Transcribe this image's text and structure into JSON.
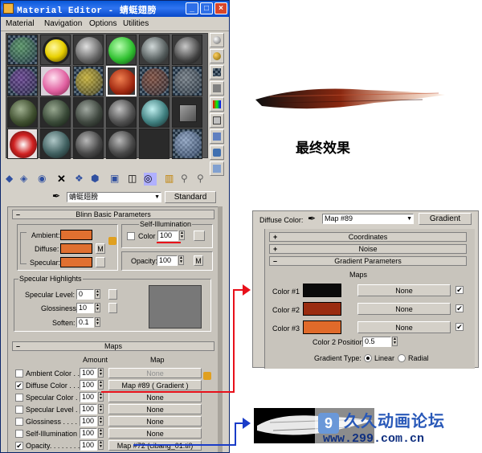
{
  "window": {
    "title": "Material Editor - 蜻蜓翅膀",
    "menu": [
      "Material",
      "Navigation",
      "Options",
      "Utilities"
    ],
    "material_name": "蜻蜓翅膀",
    "material_type": "Standard"
  },
  "blinn": {
    "header": "Blinn Basic Parameters",
    "ambient_label": "Ambient:",
    "diffuse_label": "Diffuse:",
    "specular_label": "Specular:",
    "map_btn": "M",
    "self_illum_title": "Self-Illumination",
    "color_label": "Color",
    "self_illum_value": "100",
    "opacity_label": "Opacity:",
    "opacity_value": "100",
    "opacity_map_btn": "M",
    "ambient_color": "#e07030",
    "diffuse_color": "#e07030",
    "specular_color": "#e07030"
  },
  "specular": {
    "title": "Specular Highlights",
    "level_label": "Specular Level:",
    "level_value": "0",
    "gloss_label": "Glossiness:",
    "gloss_value": "10",
    "soften_label": "Soften:",
    "soften_value": "0.1"
  },
  "maps": {
    "header": "Maps",
    "col_amount": "Amount",
    "col_map": "Map",
    "rows": [
      {
        "label": "Ambient Color . . .",
        "checked": false,
        "amount": "100",
        "map": "None",
        "enabled": false
      },
      {
        "label": "Diffuse Color . . .",
        "checked": true,
        "amount": "100",
        "map": "Map #89  ( Gradient )",
        "enabled": true
      },
      {
        "label": "Specular Color . .",
        "checked": false,
        "amount": "100",
        "map": "None",
        "enabled": true
      },
      {
        "label": "Specular Level . .",
        "checked": false,
        "amount": "100",
        "map": "None",
        "enabled": true
      },
      {
        "label": "Glossiness . . . . .",
        "checked": false,
        "amount": "100",
        "map": "None",
        "enabled": true
      },
      {
        "label": "Self-Illumination .",
        "checked": false,
        "amount": "100",
        "map": "None",
        "enabled": true
      },
      {
        "label": "Opacity. . . . . . . .",
        "checked": true,
        "amount": "100",
        "map": "Map #72 (cibang_01.tif)",
        "enabled": true
      }
    ]
  },
  "result_label": "最终效果",
  "gradient_panel": {
    "diffuse_label": "Diffuse Color:",
    "map_name": "Map #89",
    "map_type": "Gradient",
    "rollouts": [
      "Coordinates",
      "Noise",
      "Gradient Parameters"
    ],
    "maps_title": "Maps",
    "colors": [
      {
        "label": "Color #1",
        "swatch": "#0a0a0a",
        "map": "None",
        "checked": true
      },
      {
        "label": "Color #2",
        "swatch": "#9a2c10",
        "map": "None",
        "checked": true
      },
      {
        "label": "Color #3",
        "swatch": "#e06a2a",
        "map": "None",
        "checked": true
      }
    ],
    "color2_pos_label": "Color 2 Position:",
    "color2_pos_value": "0.5",
    "gradient_type_label": "Gradient Type:",
    "linear_label": "Linear",
    "radial_label": "Radial"
  },
  "watermark": {
    "line1": "久久动画论坛",
    "line2": "www.299.com.cn"
  }
}
